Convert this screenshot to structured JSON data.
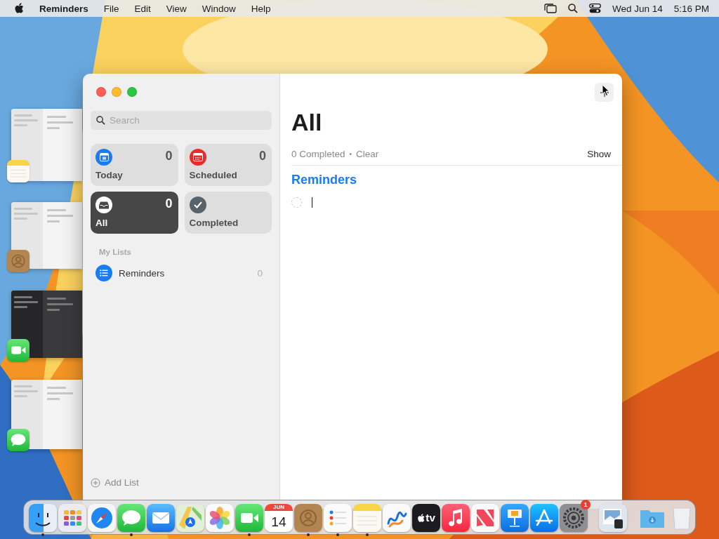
{
  "menu_bar": {
    "app_name": "Reminders",
    "menus": [
      "File",
      "Edit",
      "View",
      "Window",
      "Help"
    ],
    "date": "Wed Jun 14",
    "time": "5:16 PM"
  },
  "stage_manager": [
    {
      "kind": "notes"
    },
    {
      "kind": "contacts"
    },
    {
      "kind": "facetime"
    },
    {
      "kind": "messages"
    }
  ],
  "window": {
    "sidebar": {
      "search": {
        "placeholder": "Search"
      },
      "smart_lists": [
        {
          "kind": "today",
          "label": "Today",
          "count": "0",
          "selected": false
        },
        {
          "kind": "scheduled",
          "label": "Scheduled",
          "count": "0",
          "selected": false
        },
        {
          "kind": "all",
          "label": "All",
          "count": "0",
          "selected": true
        },
        {
          "kind": "completed",
          "label": "Completed",
          "selected": false
        }
      ],
      "my_lists_header": "My Lists",
      "lists": [
        {
          "name": "Reminders",
          "count": "0"
        }
      ],
      "add_list": "Add List"
    },
    "main": {
      "title": "All",
      "completed_count": "0 Completed",
      "separator": "•",
      "clear": "Clear",
      "show": "Show",
      "sections": [
        {
          "title": "Reminders",
          "items": [
            {
              "checked": false,
              "editing": true
            }
          ]
        }
      ]
    }
  },
  "dock": {
    "apps": [
      {
        "kind": "finder",
        "running": true
      },
      {
        "kind": "launchpad",
        "running": false
      },
      {
        "kind": "safari",
        "running": false
      },
      {
        "kind": "messages",
        "running": true
      },
      {
        "kind": "mail",
        "running": false
      },
      {
        "kind": "maps",
        "running": false
      },
      {
        "kind": "photos",
        "running": false
      },
      {
        "kind": "facetime",
        "running": true
      },
      {
        "kind": "calendar",
        "month": "JUN",
        "day": "14",
        "running": false
      },
      {
        "kind": "contacts",
        "running": true
      },
      {
        "kind": "reminders",
        "running": true
      },
      {
        "kind": "notes",
        "running": true
      },
      {
        "kind": "freeform",
        "running": false
      },
      {
        "kind": "tv",
        "label": "tv",
        "running": false
      },
      {
        "kind": "music",
        "running": false
      },
      {
        "kind": "news",
        "running": false
      },
      {
        "kind": "keynote",
        "running": false
      },
      {
        "kind": "appstore",
        "running": false
      },
      {
        "kind": "settings",
        "badge": "1",
        "running": false
      }
    ],
    "documents": [
      {
        "kind": "preview",
        "running": false
      }
    ],
    "folders": [
      {
        "kind": "downloads",
        "running": false
      },
      {
        "kind": "trash",
        "running": false
      }
    ]
  }
}
